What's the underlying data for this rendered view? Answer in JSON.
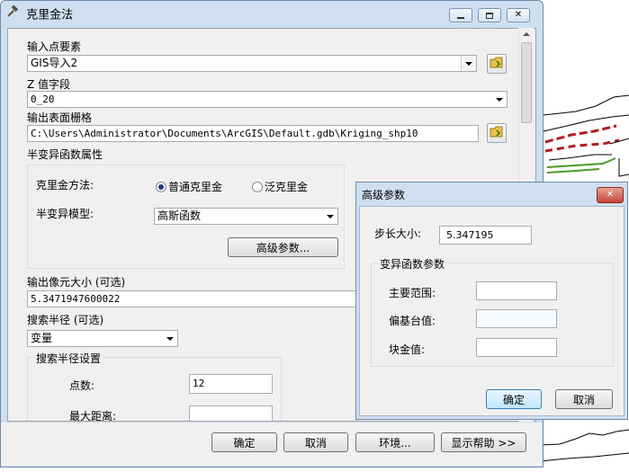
{
  "main_window": {
    "title": "克里金法",
    "title_icon": "hammer-icon",
    "controls": {
      "minimize": "minimize-icon",
      "maximize": "maximize-icon",
      "close": "close-icon"
    }
  },
  "form": {
    "input_points_label": "输入点要素",
    "input_points_value": "GIS导入2",
    "z_field_label": "Z 值字段",
    "z_field_value": "0_20",
    "output_raster_label": "输出表面栅格",
    "output_raster_value": "C:\\Users\\Administrator\\Documents\\ArcGIS\\Default.gdb\\Kriging_shp10",
    "semivariogram_section": "半变异函数属性",
    "method_label": "克里金方法:",
    "method_options": [
      "普通克里金",
      "泛克里金"
    ],
    "method_selected": "普通克里金",
    "model_label": "半变异模型:",
    "model_value": "高斯函数",
    "advanced_button": "高级参数...",
    "cell_size_label": "输出像元大小 (可选)",
    "cell_size_value": "5.3471947600022",
    "search_radius_label": "搜索半径 (可选)",
    "search_radius_value": "变量",
    "search_settings_label": "搜索半径设置",
    "points_label": "点数:",
    "points_value": "12",
    "max_distance_label": "最大距离:",
    "max_distance_value": ""
  },
  "footer": {
    "ok": "确定",
    "cancel": "取消",
    "env": "环境...",
    "help": "显示帮助 >>"
  },
  "advanced_dialog": {
    "title": "高级参数",
    "lag_label": "步长大小:",
    "lag_value": "5.347195",
    "group_label": "变异函数参数",
    "major_range_label": "主要范围:",
    "major_range_value": "",
    "partial_sill_label": "偏基台值:",
    "partial_sill_value": "",
    "nugget_label": "块金值:",
    "nugget_value": "",
    "ok": "确定",
    "cancel": "取消"
  },
  "colors": {
    "title_bar": "#cfdff0",
    "map_red": "#b01e1e",
    "map_green": "#4a9a28",
    "radio_dot": "#1e3f73"
  }
}
